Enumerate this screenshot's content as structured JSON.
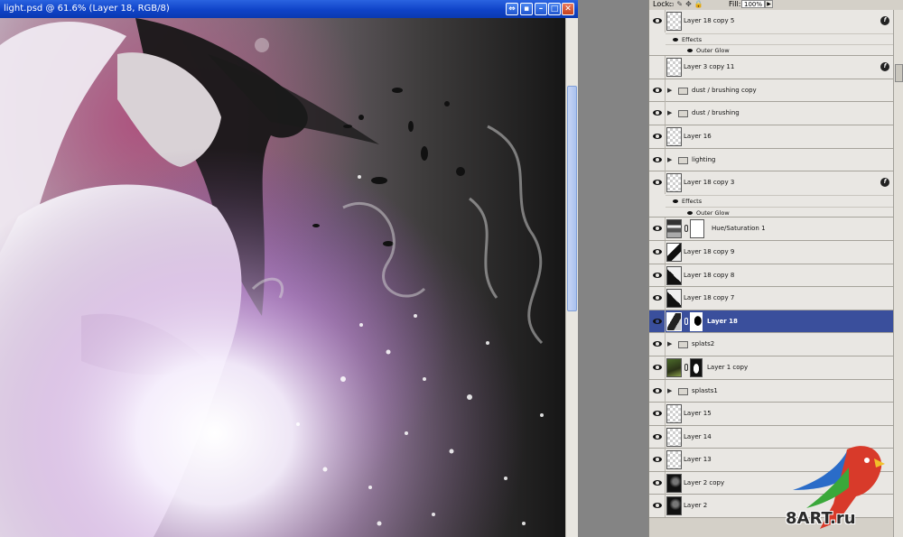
{
  "document": {
    "title": "light.psd @ 61.6% (Layer 18, RGB/8)",
    "window_buttons": [
      "restore-icon",
      "menu-icon",
      "minimize-icon",
      "maximize-icon",
      "close-icon"
    ]
  },
  "layers_panel": {
    "lock_label": "Lock:",
    "fill_label": "Fill:",
    "fill_value": "100%",
    "layers": [
      {
        "name": "Layer 18 copy 5",
        "visible": true,
        "fx": true,
        "effects_label": "Effects",
        "effect": "Outer Glow"
      },
      {
        "name": "Layer 3 copy 11",
        "visible": false,
        "fx_badge": true
      },
      {
        "name": "dust / brushing copy",
        "visible": true,
        "group": true
      },
      {
        "name": "dust / brushing",
        "visible": true,
        "group": true
      },
      {
        "name": "Layer 16",
        "visible": true
      },
      {
        "name": "lighting",
        "visible": true,
        "group": true
      },
      {
        "name": "Layer 18 copy 3",
        "visible": true,
        "fx": true,
        "effects_label": "Effects",
        "effect": "Outer Glow"
      },
      {
        "name": "Hue/Saturation 1",
        "visible": true,
        "adjustment": true
      },
      {
        "name": "Layer 18 copy 9",
        "visible": true
      },
      {
        "name": "Layer 18 copy 8",
        "visible": true
      },
      {
        "name": "Layer 18 copy 7",
        "visible": true
      },
      {
        "name": "Layer 18",
        "visible": true,
        "selected": true,
        "masked": true
      },
      {
        "name": "splats2",
        "visible": true,
        "group": true
      },
      {
        "name": "Layer 1 copy",
        "visible": true,
        "masked": true
      },
      {
        "name": "splasts1",
        "visible": true,
        "group": true
      },
      {
        "name": "Layer 15",
        "visible": true
      },
      {
        "name": "Layer 14",
        "visible": true
      },
      {
        "name": "Layer 13",
        "visible": true
      },
      {
        "name": "Layer 2 copy",
        "visible": true
      },
      {
        "name": "Layer 2",
        "visible": true
      }
    ]
  },
  "watermark": {
    "text": "8ART.ru"
  },
  "colors": {
    "titlebar": "#0f43c8",
    "selected_layer": "#3a4f9c",
    "panel_bg": "#d4d0c8",
    "workspace": "#848484"
  }
}
